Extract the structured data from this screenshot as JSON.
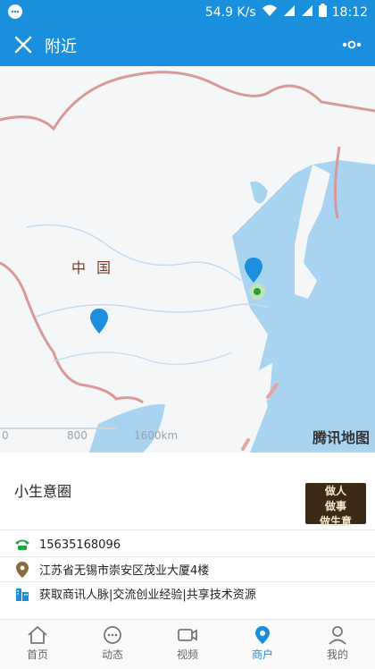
{
  "status": {
    "speed": "54.9 K/s",
    "time": "18:12"
  },
  "header": {
    "title": "附近"
  },
  "map": {
    "country_label": "中国",
    "scale_labels": [
      "0",
      "800",
      "1600km"
    ],
    "brand": "腾讯地图"
  },
  "shop": {
    "name": "小生意圈",
    "logo_lines": [
      "做人",
      "做事",
      "做生意"
    ],
    "phone": "15635168096",
    "address": "江苏省无锡市崇安区茂业大厦4楼",
    "description": "获取商讯人脉|交流创业经验|共享技术资源"
  },
  "nav": {
    "items": [
      {
        "label": "首页",
        "icon": "home-icon"
      },
      {
        "label": "动态",
        "icon": "chat-bubble-icon"
      },
      {
        "label": "视频",
        "icon": "video-camera-icon"
      },
      {
        "label": "商户",
        "icon": "map-pin-icon"
      },
      {
        "label": "我的",
        "icon": "user-icon"
      }
    ],
    "active_index": 3
  },
  "colors": {
    "primary": "#1b8fdd",
    "water": "#a9d4f1"
  }
}
